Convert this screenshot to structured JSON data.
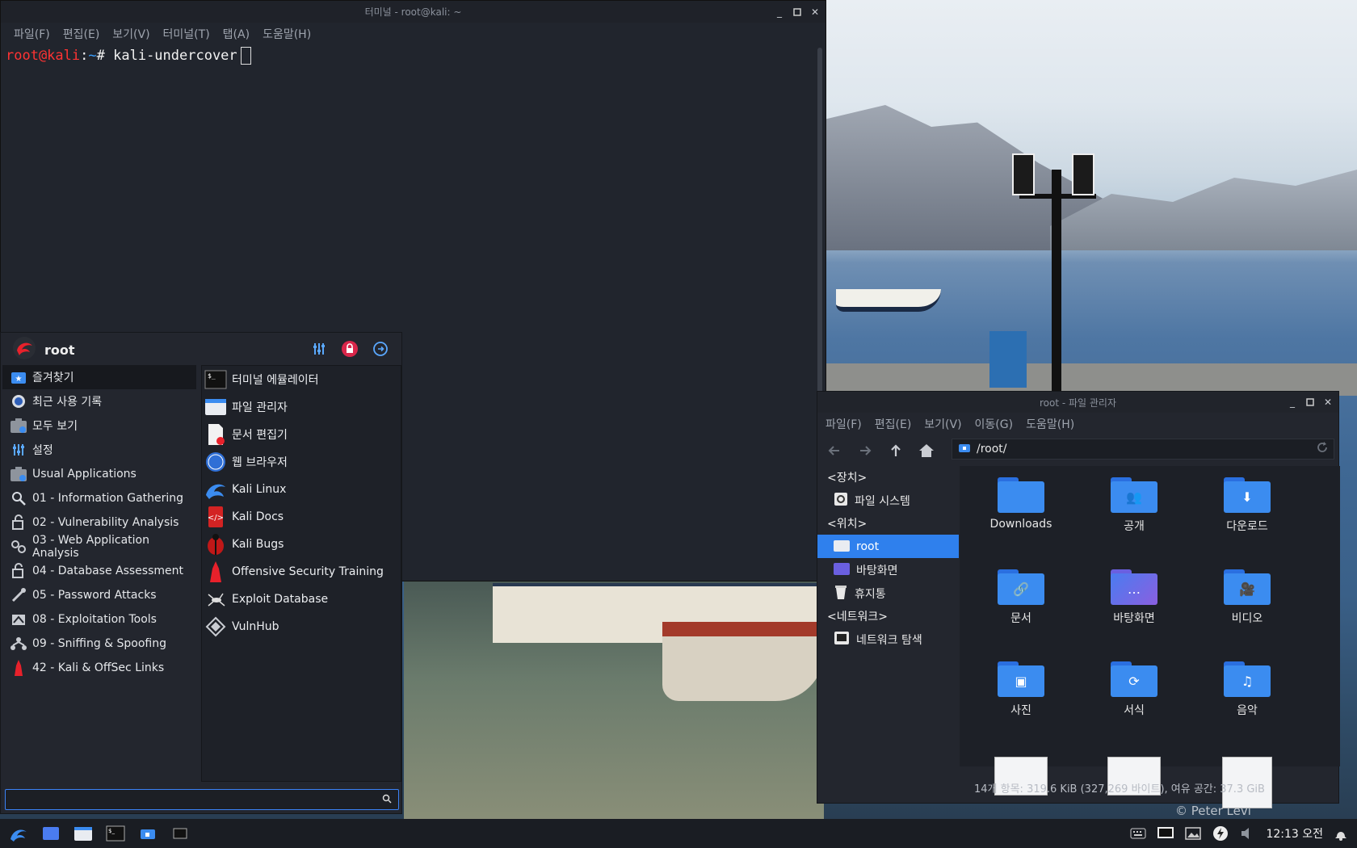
{
  "terminal": {
    "title": "터미널 - root@kali: ~",
    "menu": [
      "파일(F)",
      "편집(E)",
      "보기(V)",
      "터미널(T)",
      "탭(A)",
      "도움말(H)"
    ],
    "prompt_user": "root@kali",
    "prompt_sep": ":",
    "prompt_path": "~",
    "prompt_symbol": "#",
    "command": "kali-undercover"
  },
  "whisker": {
    "username": "root",
    "categories": [
      {
        "label": "즐겨찾기",
        "icon": "star-folder-icon"
      },
      {
        "label": "최근 사용 기록",
        "icon": "recent-icon"
      },
      {
        "label": "모두 보기",
        "icon": "all-apps-icon"
      },
      {
        "label": "설정",
        "icon": "settings-icon"
      },
      {
        "label": "Usual Applications",
        "icon": "usual-apps-icon"
      },
      {
        "label": "01 - Information Gathering",
        "icon": "magnifier-icon"
      },
      {
        "label": "02 - Vulnerability Analysis",
        "icon": "vuln-icon"
      },
      {
        "label": "03 - Web Application Analysis",
        "icon": "web-gears-icon"
      },
      {
        "label": "04 - Database Assessment",
        "icon": "database-icon"
      },
      {
        "label": "05 - Password Attacks",
        "icon": "password-icon"
      },
      {
        "label": "08 - Exploitation Tools",
        "icon": "exploit-icon"
      },
      {
        "label": "09 - Sniffing & Spoofing",
        "icon": "sniffing-icon"
      },
      {
        "label": "42 - Kali & OffSec Links",
        "icon": "kali-links-icon"
      }
    ],
    "apps": [
      {
        "label": "터미널 에뮬레이터",
        "icon": "terminal-icon"
      },
      {
        "label": "파일 관리자",
        "icon": "file-manager-icon"
      },
      {
        "label": "문서 편집기",
        "icon": "text-editor-icon"
      },
      {
        "label": "웹 브라우저",
        "icon": "web-browser-icon"
      },
      {
        "label": "Kali Linux",
        "icon": "kali-dragon-icon"
      },
      {
        "label": "Kali Docs",
        "icon": "kali-docs-icon"
      },
      {
        "label": "Kali Bugs",
        "icon": "kali-bugs-icon"
      },
      {
        "label": "Offensive Security Training",
        "icon": "offsec-icon"
      },
      {
        "label": "Exploit Database",
        "icon": "exploitdb-icon"
      },
      {
        "label": "VulnHub",
        "icon": "vulnhub-icon"
      }
    ],
    "search_value": ""
  },
  "filemanager": {
    "title": "root - 파일 관리자",
    "menu": [
      "파일(F)",
      "편집(E)",
      "보기(V)",
      "이동(G)",
      "도움말(H)"
    ],
    "location": "/root/",
    "side": {
      "devices_header": "<장치>",
      "filesystem": "파일 시스템",
      "places_header": "<위치>",
      "root": "root",
      "desktop": "바탕화면",
      "trash": "휴지통",
      "network_header": "<네트워크>",
      "network_browse": "네트워크 탐색"
    },
    "items": [
      {
        "label": "Downloads",
        "glyph": ""
      },
      {
        "label": "공개",
        "glyph": "👥"
      },
      {
        "label": "다운로드",
        "glyph": "⬇"
      },
      {
        "label": "문서",
        "glyph": "🔗"
      },
      {
        "label": "바탕화면",
        "glyph": "…"
      },
      {
        "label": "비디오",
        "glyph": "🎥"
      },
      {
        "label": "사진",
        "glyph": "▣"
      },
      {
        "label": "서식",
        "glyph": "⟳"
      },
      {
        "label": "음악",
        "glyph": "♫"
      }
    ],
    "status": "14개 항목: 319.6 KiB (327,269 바이트), 여유 공간: 37.3 GiB"
  },
  "wallpaper": {
    "credit": "© Peter Levi"
  },
  "taskbar": {
    "clock": "12:13 오전"
  },
  "colors": {
    "accent": "#2f80ed",
    "kali_red": "#e8212b",
    "prompt_user": "#ff3333",
    "prompt_path": "#3aa0ff"
  }
}
